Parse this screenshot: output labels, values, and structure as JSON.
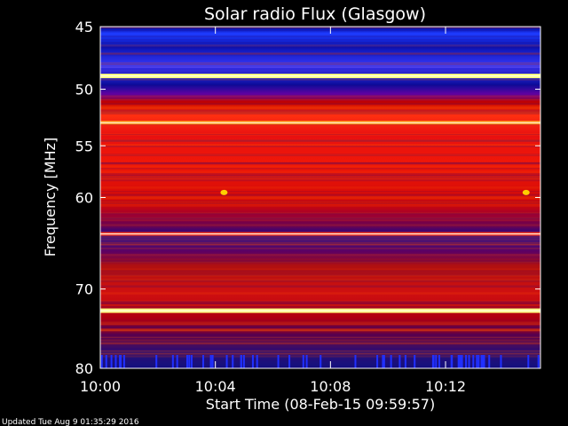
{
  "chart_data": {
    "type": "heatmap",
    "title": "Solar radio Flux (Glasgow)",
    "xlabel": "Start Time (08-Feb-15 09:59:57)",
    "ylabel": "Frequency [MHz]",
    "x_ticks": [
      "10:00",
      "10:04",
      "10:08",
      "10:12"
    ],
    "y_ticks": [
      45,
      50,
      55,
      60,
      70,
      80
    ],
    "xlim_minutes": [
      0,
      15.3
    ],
    "ylim": [
      45,
      80
    ],
    "y_scale": "log",
    "colormap": [
      "#0000a0",
      "#1e3cff",
      "#b40000",
      "#ff2000",
      "#ffd000",
      "#ffffff"
    ],
    "horizontal_bands": [
      {
        "freq": 48.9,
        "intensity": "bright-yellow"
      },
      {
        "freq": 52.9,
        "intensity": "orange"
      },
      {
        "freq": 63.8,
        "intensity": "red"
      },
      {
        "freq": 72.6,
        "intensity": "bright-yellow"
      }
    ],
    "bursts": [
      {
        "time": "10:04.3",
        "freq": 59.5
      },
      {
        "time": "10:14.8",
        "freq": 59.5
      }
    ]
  },
  "footer": {
    "updated": "Updated Tue Aug  9 01:35:29 2016"
  }
}
